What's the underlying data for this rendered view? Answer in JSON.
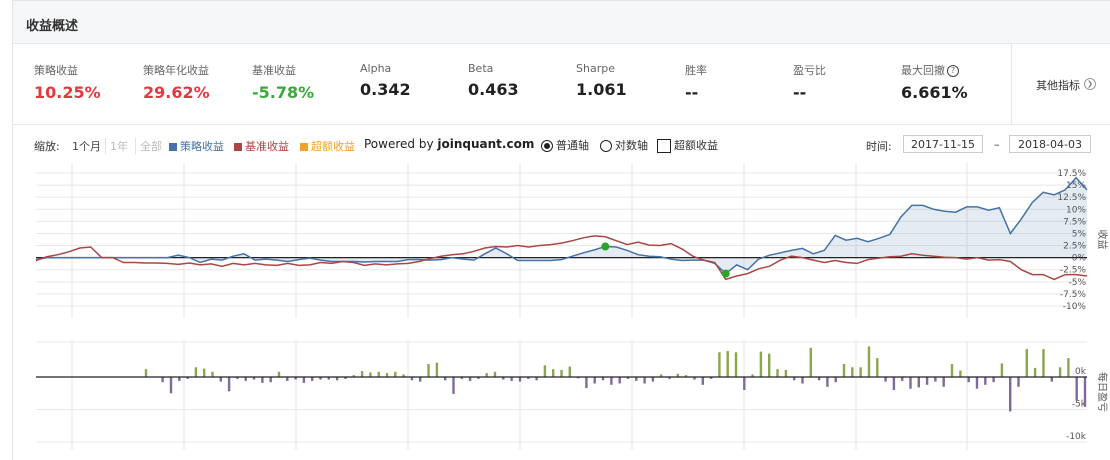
{
  "header": {
    "title": "收益概述"
  },
  "metrics": [
    {
      "label": "策略收益",
      "value": "10.25%",
      "tone": "red"
    },
    {
      "label": "策略年化收益",
      "value": "29.62%",
      "tone": "red"
    },
    {
      "label": "基准收益",
      "value": "-5.78%",
      "tone": "green"
    },
    {
      "label": "Alpha",
      "value": "0.342",
      "tone": ""
    },
    {
      "label": "Beta",
      "value": "0.463",
      "tone": ""
    },
    {
      "label": "Sharpe",
      "value": "1.061",
      "tone": ""
    },
    {
      "label": "胜率",
      "value": "--",
      "tone": ""
    },
    {
      "label": "盈亏比",
      "value": "--",
      "tone": ""
    },
    {
      "label": "最大回撤",
      "value": "6.661%",
      "tone": "",
      "help": "?"
    }
  ],
  "other_metrics": {
    "label": "其他指标",
    "icon": "chevron-right-icon"
  },
  "toolbar": {
    "zoom_label": "缩放:",
    "zoom_options": [
      "1个月",
      "1年",
      "全部"
    ],
    "legend": [
      {
        "name": "策略收益",
        "color": "#4572a7"
      },
      {
        "name": "基准收益",
        "color": "#aa4643"
      },
      {
        "name": "超额收益",
        "color": "#f0a030"
      }
    ],
    "powered_prefix": "Powered by ",
    "powered_site": "joinquant.com",
    "axis_normal": "普通轴",
    "axis_log": "对数轴",
    "excess_checkbox": "超额收益",
    "time_label": "时间:",
    "date_from": "2017-11-15",
    "date_sep": "–",
    "date_to": "2018-04-03"
  },
  "chart_data": [
    {
      "type": "line",
      "ylabel": "收益",
      "ylim": [
        -10,
        17.5
      ],
      "y_ticks": [
        "17.5%",
        "15%",
        "12.5%",
        "10%",
        "7.5%",
        "5%",
        "2.5%",
        "0%",
        "-2.5%",
        "-5%",
        "-7.5%",
        "-10%"
      ],
      "series": [
        {
          "name": "策略收益",
          "color": "#4572a7",
          "fill": true,
          "values": [
            -0.4,
            0,
            0,
            0,
            0,
            0,
            0,
            0,
            0,
            0,
            0,
            0,
            0,
            0.5,
            0,
            -1,
            -0.3,
            -0.5,
            0.3,
            0.8,
            -0.5,
            -0.3,
            -0.5,
            -0.8,
            -0.4,
            -0.1,
            -0.5,
            -0.8,
            -0.8,
            -0.8,
            -0.9,
            -0.8,
            -0.8,
            -0.8,
            -0.4,
            -0.4,
            -0.5,
            -0.4,
            0,
            -0.3,
            -0.5,
            0.8,
            2,
            0.8,
            -0.6,
            -0.6,
            -0.6,
            -0.6,
            -0.4,
            0.3,
            1,
            1.6,
            2.3,
            2.2,
            1.5,
            0.6,
            0.3,
            0.2,
            -0.3,
            -0.6,
            -0.5,
            -0.5,
            -1.2,
            -3.3,
            -1.5,
            -2.5,
            -0.3,
            0.5,
            1,
            1.5,
            1.9,
            0.8,
            1.5,
            4.6,
            3.6,
            4,
            3.3,
            4,
            4.8,
            8.4,
            10.8,
            10.8,
            10,
            9.6,
            9.4,
            10.5,
            10.5,
            9.8,
            10.3,
            5,
            8,
            11.4,
            13.5,
            13,
            14,
            16.5,
            14
          ],
          "markers": [
            {
              "index": 52,
              "y": 2.3
            },
            {
              "index": 63,
              "y": -3.3
            }
          ]
        },
        {
          "name": "基准收益",
          "color": "#aa4643",
          "fill": false,
          "values": [
            -0.6,
            0.2,
            0.6,
            1.2,
            2,
            2.2,
            0,
            0,
            -1,
            -1,
            -1.1,
            -1.1,
            -1.2,
            -1.4,
            -1.1,
            -1.5,
            -1.3,
            -1.8,
            -1.2,
            -1.5,
            -1.2,
            -1.5,
            -1.6,
            -1.2,
            -1.6,
            -1.5,
            -1,
            -1.2,
            -0.8,
            -1,
            -1.6,
            -1.3,
            -1.5,
            -1.3,
            -1.2,
            -0.8,
            -0.2,
            0.3,
            0.6,
            0.8,
            1.3,
            2,
            2.3,
            2.2,
            2.5,
            2.2,
            2.5,
            2.7,
            3,
            3.5,
            4.1,
            4.5,
            4.3,
            3.5,
            2.7,
            3.2,
            2.6,
            2.5,
            2.9,
            1.8,
            0.3,
            -0.5,
            -1,
            -4.5,
            -3.8,
            -3.3,
            -2.3,
            -1.8,
            -0.5,
            0.3,
            0,
            -0.5,
            -1,
            -0.6,
            -1,
            -1.2,
            -0.4,
            -0.1,
            0.2,
            0.3,
            0.8,
            0.5,
            0.3,
            0.1,
            0,
            -0.3,
            0,
            -0.5,
            -0.4,
            -0.8,
            -2.5,
            -3.5,
            -3.5,
            -4.5,
            -3.5,
            -3.5,
            -3.8
          ]
        }
      ]
    },
    {
      "type": "bar",
      "ylabel": "每日盈亏",
      "ylim": [
        -10000,
        1000
      ],
      "y_ticks": [
        "0k",
        "-5k",
        "-10k"
      ],
      "series": [
        {
          "name": "每日盈亏",
          "positive_color": "#89a54e",
          "negative_color": "#80699b",
          "values": [
            0,
            0,
            0,
            0,
            0,
            0,
            0,
            0,
            0,
            0,
            0,
            0,
            0,
            1200,
            0,
            -800,
            -2500,
            -600,
            -300,
            1500,
            1300,
            800,
            -700,
            -2200,
            -300,
            -600,
            -400,
            -900,
            -800,
            800,
            -600,
            -400,
            -900,
            -600,
            -400,
            -400,
            -500,
            -300,
            300,
            900,
            700,
            800,
            600,
            800,
            400,
            -500,
            -700,
            2000,
            2200,
            -500,
            -2600,
            -300,
            -600,
            -300,
            600,
            800,
            -400,
            -600,
            -700,
            -300,
            -500,
            1800,
            1200,
            1100,
            1600,
            -200,
            -1700,
            -1000,
            -500,
            -1200,
            -1000,
            -300,
            -600,
            -1000,
            -700,
            400,
            -300,
            500,
            300,
            -400,
            -1200,
            -300,
            3800,
            4000,
            3800,
            -2000,
            400,
            3900,
            3600,
            1200,
            1100,
            -500,
            -1000,
            4500,
            -500,
            -1500,
            -800,
            2000,
            1500,
            1500,
            4700,
            2900,
            -700,
            -2000,
            -600,
            -1800,
            -1600,
            -1200,
            -700,
            -1500,
            2000,
            1000,
            -800,
            -1800,
            -1200,
            -800,
            2100,
            -5300,
            -1500,
            4300,
            1400,
            4300,
            -700,
            1500,
            2900,
            -3600,
            -4600
          ]
        }
      ]
    }
  ]
}
